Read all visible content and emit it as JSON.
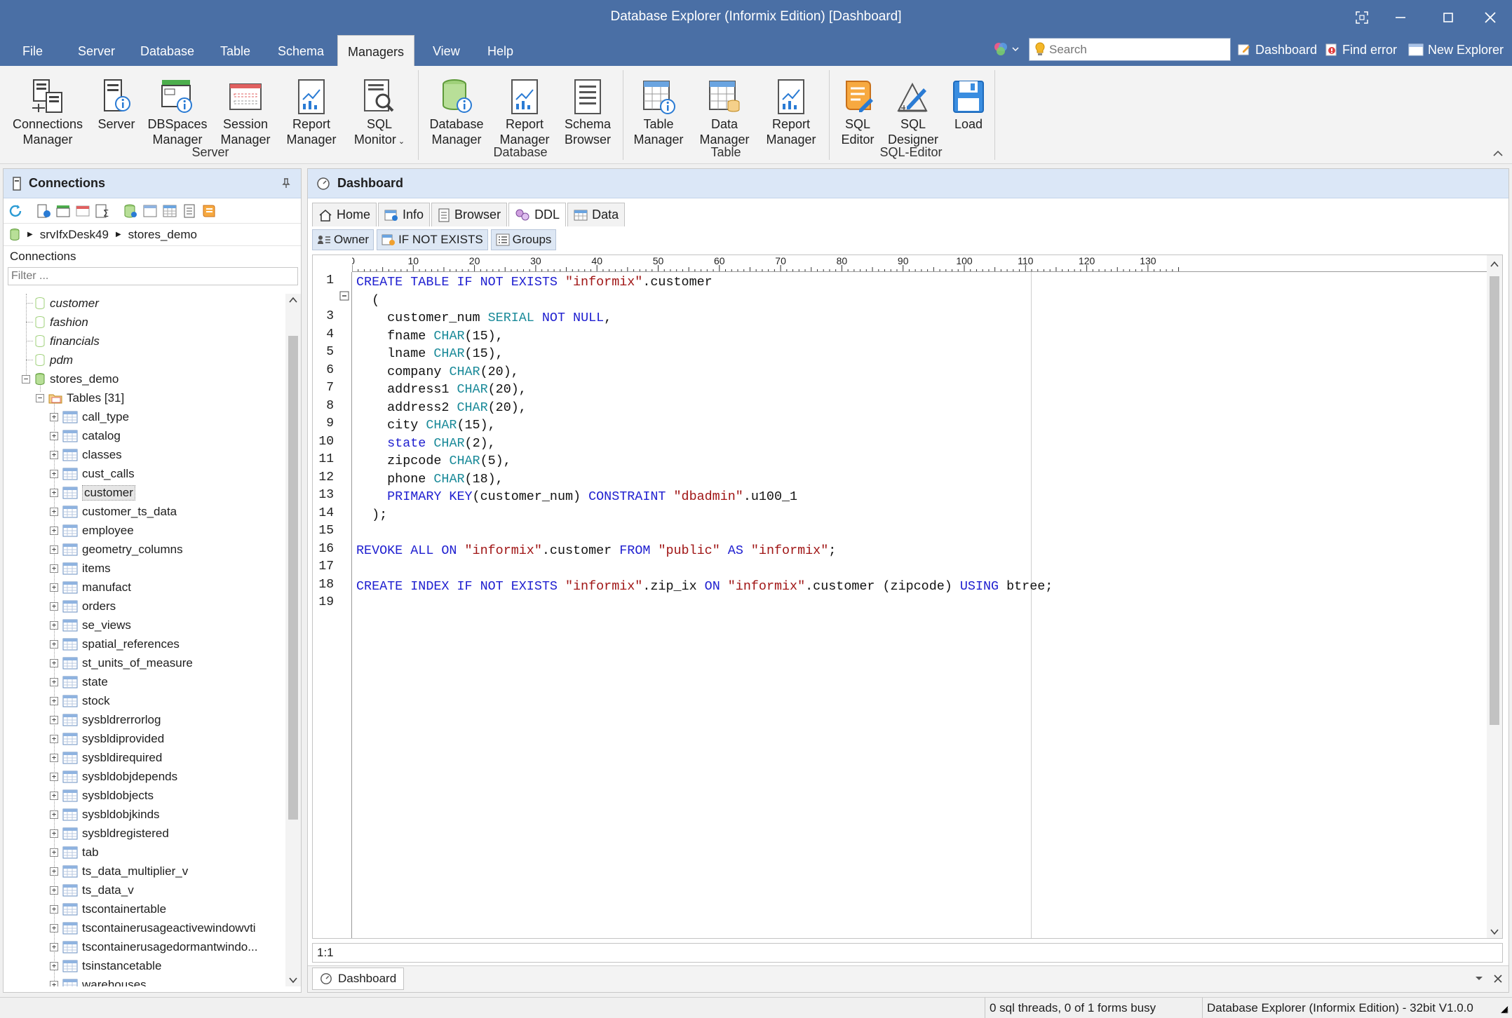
{
  "window": {
    "title": "Database Explorer (Informix Edition) [Dashboard]"
  },
  "menu": {
    "items": [
      "File",
      "Server",
      "Database",
      "Table",
      "Schema",
      "Managers",
      "View",
      "Help"
    ],
    "active": "Managers"
  },
  "quick": {
    "search_placeholder": "Search",
    "dashboard": "Dashboard",
    "find_error": "Find error",
    "new_explorer": "New Explorer"
  },
  "ribbon": {
    "groups": [
      {
        "label": "Server",
        "buttons": [
          {
            "line1": "Connections",
            "line2": "Manager"
          },
          {
            "line1": "Server",
            "line2": ""
          },
          {
            "line1": "DBSpaces",
            "line2": "Manager"
          },
          {
            "line1": "Session",
            "line2": "Manager"
          },
          {
            "line1": "Report",
            "line2": "Manager"
          },
          {
            "line1": "SQL",
            "line2": "Monitor"
          }
        ]
      },
      {
        "label": "Database",
        "buttons": [
          {
            "line1": "Database",
            "line2": "Manager"
          },
          {
            "line1": "Report",
            "line2": "Manager"
          },
          {
            "line1": "Schema",
            "line2": "Browser"
          }
        ]
      },
      {
        "label": "Table",
        "buttons": [
          {
            "line1": "Table",
            "line2": "Manager"
          },
          {
            "line1": "Data",
            "line2": "Manager"
          },
          {
            "line1": "Report",
            "line2": "Manager"
          }
        ]
      },
      {
        "label": "SQL-Editor",
        "buttons": [
          {
            "line1": "SQL",
            "line2": "Editor"
          },
          {
            "line1": "SQL",
            "line2": "Designer"
          },
          {
            "line1": "Load",
            "line2": ""
          }
        ]
      }
    ]
  },
  "connections": {
    "title": "Connections",
    "crumb": [
      "srvIfxDesk49",
      "stores_demo"
    ],
    "section_label": "Connections",
    "filter_placeholder": "Filter ...",
    "databases_italic": [
      "customer",
      "fashion",
      "financials",
      "pdm"
    ],
    "active_db": "stores_demo",
    "tables_folder": "Tables [31]",
    "selected_table": "customer",
    "tables": [
      "call_type",
      "catalog",
      "classes",
      "cust_calls",
      "customer",
      "customer_ts_data",
      "employee",
      "geometry_columns",
      "items",
      "manufact",
      "orders",
      "se_views",
      "spatial_references",
      "st_units_of_measure",
      "state",
      "stock",
      "sysbldrerrorlog",
      "sysbldiprovided",
      "sysbldirequired",
      "sysbldobjdepends",
      "sysbldobjects",
      "sysbldobjkinds",
      "sysbldregistered",
      "tab",
      "ts_data_multiplier_v",
      "ts_data_v",
      "tscontainertable",
      "tscontainerusageactivewindowvti",
      "tscontainerusagedormantwindo...",
      "tsinstancetable",
      "warehouses"
    ]
  },
  "dashboard": {
    "title": "Dashboard",
    "tabs": [
      "Home",
      "Info",
      "Browser",
      "DDL",
      "Data"
    ],
    "active_tab": "DDL",
    "subtabs": [
      "Owner",
      "IF NOT EXISTS",
      "Groups"
    ],
    "ruler_labels": [
      "0",
      "10",
      "20",
      "30",
      "40",
      "50",
      "60",
      "70",
      "80",
      "90",
      "100",
      "110",
      "120",
      "130"
    ],
    "line_numbers": [
      "1",
      "",
      "3",
      "4",
      "5",
      "6",
      "7",
      "8",
      "9",
      "10",
      "11",
      "12",
      "13",
      "14",
      "15",
      "16",
      "17",
      "18",
      "19"
    ],
    "code_lines": [
      [
        [
          "kw",
          "CREATE TABLE IF NOT EXISTS "
        ],
        [
          "str",
          "\"informix\""
        ],
        [
          "plain",
          ".customer"
        ]
      ],
      [
        [
          "plain",
          "  ("
        ]
      ],
      [
        [
          "plain",
          "    customer_num "
        ],
        [
          "ty",
          "SERIAL "
        ],
        [
          "kw",
          "NOT NULL"
        ],
        [
          "plain",
          ","
        ]
      ],
      [
        [
          "plain",
          "    fname "
        ],
        [
          "ty",
          "CHAR"
        ],
        [
          "plain",
          "(15),"
        ]
      ],
      [
        [
          "plain",
          "    lname "
        ],
        [
          "ty",
          "CHAR"
        ],
        [
          "plain",
          "(15),"
        ]
      ],
      [
        [
          "plain",
          "    company "
        ],
        [
          "ty",
          "CHAR"
        ],
        [
          "plain",
          "(20),"
        ]
      ],
      [
        [
          "plain",
          "    address1 "
        ],
        [
          "ty",
          "CHAR"
        ],
        [
          "plain",
          "(20),"
        ]
      ],
      [
        [
          "plain",
          "    address2 "
        ],
        [
          "ty",
          "CHAR"
        ],
        [
          "plain",
          "(20),"
        ]
      ],
      [
        [
          "plain",
          "    city "
        ],
        [
          "ty",
          "CHAR"
        ],
        [
          "plain",
          "(15),"
        ]
      ],
      [
        [
          "kw",
          "    state "
        ],
        [
          "ty",
          "CHAR"
        ],
        [
          "plain",
          "(2),"
        ]
      ],
      [
        [
          "plain",
          "    zipcode "
        ],
        [
          "ty",
          "CHAR"
        ],
        [
          "plain",
          "(5),"
        ]
      ],
      [
        [
          "plain",
          "    phone "
        ],
        [
          "ty",
          "CHAR"
        ],
        [
          "plain",
          "(18),"
        ]
      ],
      [
        [
          "kw",
          "    PRIMARY KEY"
        ],
        [
          "plain",
          "(customer_num) "
        ],
        [
          "kw",
          "CONSTRAINT "
        ],
        [
          "str",
          "\"dbadmin\""
        ],
        [
          "plain",
          ".u100_1"
        ]
      ],
      [
        [
          "plain",
          "  );"
        ]
      ],
      [
        [
          "plain",
          ""
        ]
      ],
      [
        [
          "kw",
          "REVOKE ALL ON "
        ],
        [
          "str",
          "\"informix\""
        ],
        [
          "plain",
          ".customer "
        ],
        [
          "kw",
          "FROM "
        ],
        [
          "str",
          "\"public\" "
        ],
        [
          "kw",
          "AS "
        ],
        [
          "str",
          "\"informix\""
        ],
        [
          "plain",
          ";"
        ]
      ],
      [
        [
          "plain",
          ""
        ]
      ],
      [
        [
          "kw",
          "CREATE INDEX IF NOT EXISTS "
        ],
        [
          "str",
          "\"informix\""
        ],
        [
          "plain",
          ".zip_ix "
        ],
        [
          "kw",
          "ON "
        ],
        [
          "str",
          "\"informix\""
        ],
        [
          "plain",
          ".customer (zipcode) "
        ],
        [
          "kw",
          "USING "
        ],
        [
          "plain",
          "btree;"
        ]
      ],
      [
        [
          "plain",
          ""
        ]
      ]
    ],
    "cursor_pos": "1:1",
    "doc_tab": "Dashboard"
  },
  "status": {
    "threads": "0 sql threads, 0 of 1 forms busy",
    "version": "Database Explorer (Informix Edition) - 32bit V1.0.0"
  }
}
